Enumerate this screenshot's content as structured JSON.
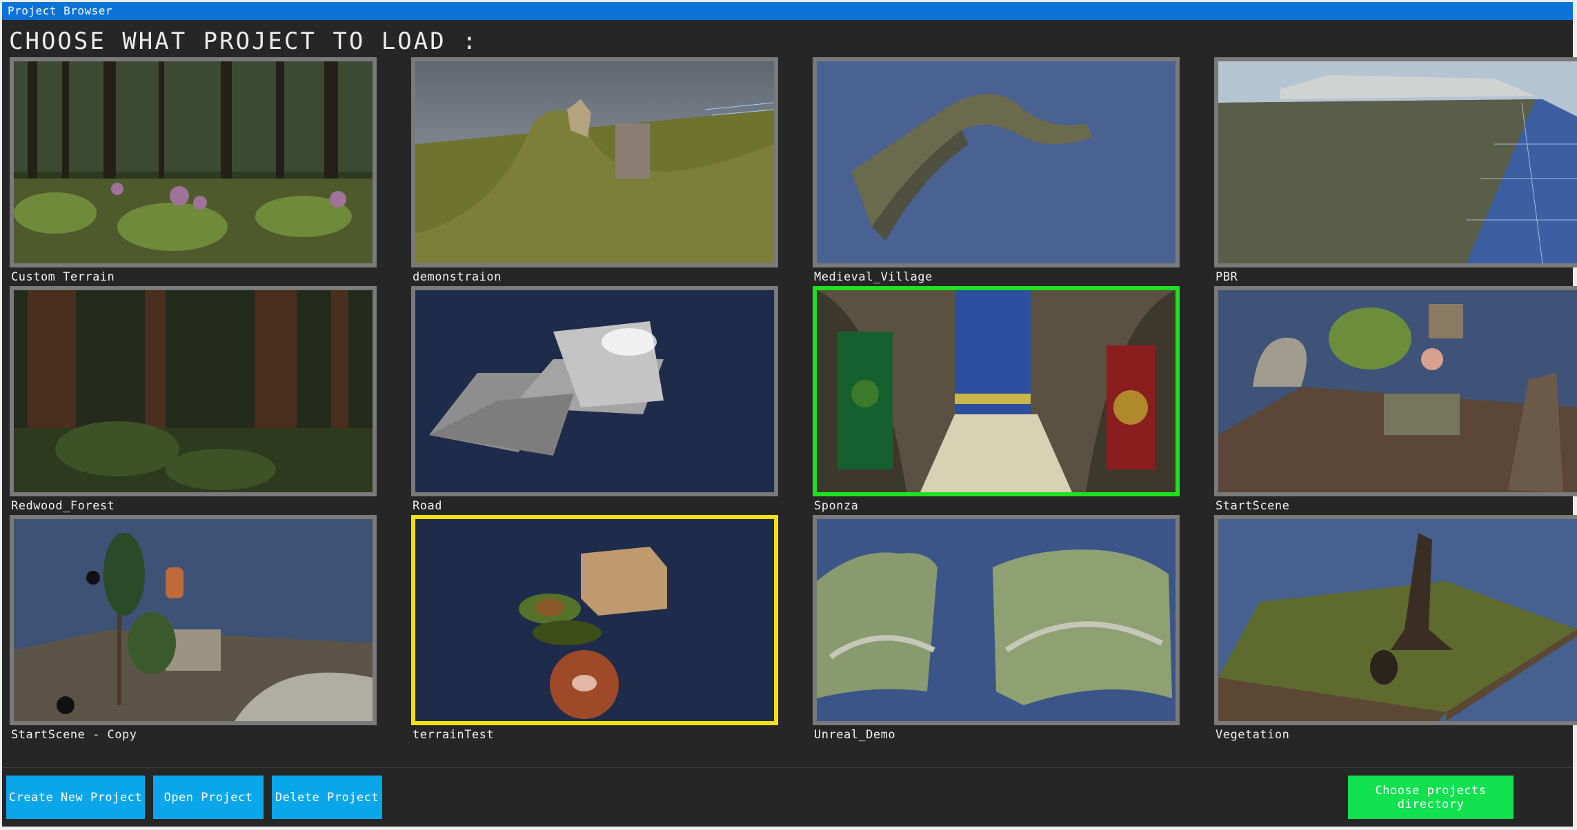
{
  "window": {
    "title": "Project Browser"
  },
  "heading": "CHOOSE WHAT PROJECT TO LOAD :",
  "projects": [
    {
      "label": "Custom Terrain",
      "selection": "none"
    },
    {
      "label": "demonstraion",
      "selection": "none"
    },
    {
      "label": "Medieval_Village",
      "selection": "none"
    },
    {
      "label": "PBR",
      "selection": "none"
    },
    {
      "label": "Redwood_Forest",
      "selection": "none"
    },
    {
      "label": "Road",
      "selection": "none"
    },
    {
      "label": "Sponza",
      "selection": "selected"
    },
    {
      "label": "StartScene",
      "selection": "none"
    },
    {
      "label": "StartScene - Copy",
      "selection": "none"
    },
    {
      "label": "terrainTest",
      "selection": "hovered"
    },
    {
      "label": "Unreal_Demo",
      "selection": "none"
    },
    {
      "label": "Vegetation",
      "selection": "none"
    }
  ],
  "buttons": {
    "create": "Create New Project",
    "open": "Open Project",
    "delete": "Delete Project",
    "choose_dir": "Choose projects directory"
  },
  "colors": {
    "titlebar": "#0b72d6",
    "selected_border": "#1de21d",
    "hover_border": "#f2e20c",
    "button": "#0aa6ea",
    "button_alt": "#11e04f"
  }
}
